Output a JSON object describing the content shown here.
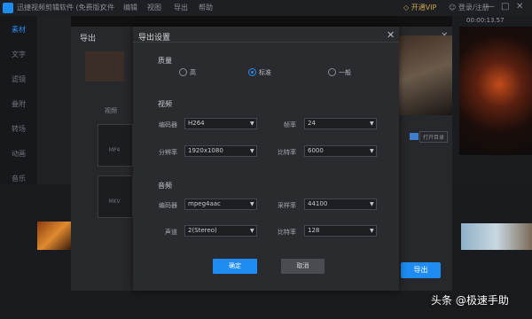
{
  "app": {
    "title": "迅捷视频剪辑软件 (免费版)",
    "menus": [
      "文件",
      "编辑",
      "视图",
      "导出",
      "帮助"
    ],
    "vip_label": "开通VIP",
    "login_label": "登录/注册",
    "window_buttons": [
      "—",
      "□",
      "✕"
    ]
  },
  "sidebar": {
    "items": [
      "素材",
      "文字",
      "滤镜",
      "叠附",
      "转场",
      "动画",
      "音乐"
    ]
  },
  "preview": {
    "time": "00:00:13.57"
  },
  "background_dialog": {
    "title": "导出",
    "close": "✕",
    "tab": "视频",
    "formats": [
      "MP4",
      "MKV"
    ],
    "open_folder_label": "打开目录",
    "export_label": "导出"
  },
  "dialog": {
    "title": "导出设置",
    "close_glyph": "✕",
    "quality": {
      "title": "质量",
      "options": [
        "高",
        "标准",
        "一般"
      ],
      "selected": "标准"
    },
    "video": {
      "title": "视频",
      "encoder_label": "编码器",
      "encoder_value": "H264",
      "framerate_label": "帧率",
      "framerate_value": "24",
      "resolution_label": "分辨率",
      "resolution_value": "1920x1080",
      "bitrate_label": "比特率",
      "bitrate_value": "6000"
    },
    "audio": {
      "title": "音频",
      "encoder_label": "编码器",
      "encoder_value": "mpeg4aac",
      "samplerate_label": "采样率",
      "samplerate_value": "44100",
      "channel_label": "声道",
      "channel_value": "2(Stereo)",
      "bitrate_label": "比特率",
      "bitrate_value": "128"
    },
    "ok_label": "确定",
    "cancel_label": "取消"
  },
  "watermark": "头条 @极速手助"
}
